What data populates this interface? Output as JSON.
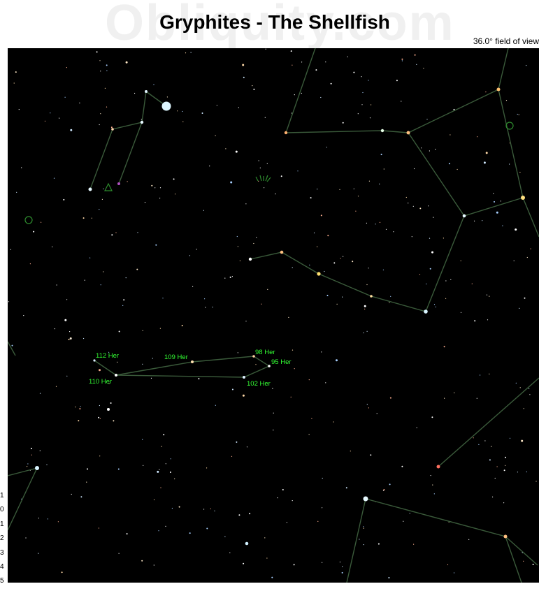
{
  "header": {
    "watermark": "Obliquity.com",
    "title": "Gryphites - The Shellfish",
    "field_of_view": "36.0° field of view"
  },
  "magnitude_scale": [
    "1",
    "0",
    "1",
    "2",
    "3",
    "4",
    "5"
  ],
  "star_labels": [
    "112 Her",
    "109 Her",
    "98 Her",
    "95 Her",
    "110 Her",
    "102 Her"
  ],
  "colors": {
    "sky": "#000000",
    "constellation_line": "#3a5a3a",
    "label": "#33ff33",
    "deep_sky": "#2e8b2e"
  }
}
